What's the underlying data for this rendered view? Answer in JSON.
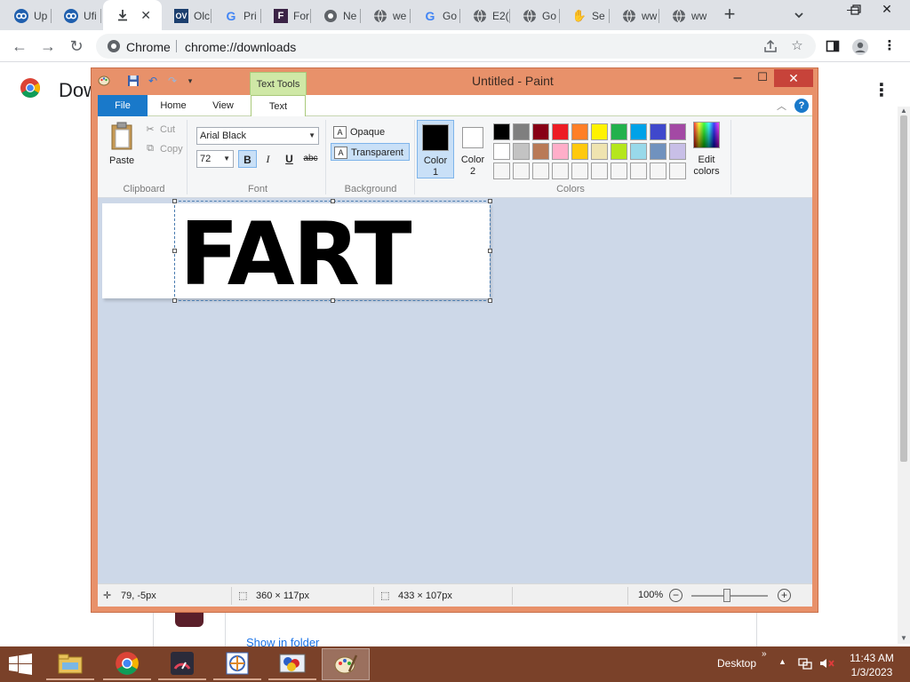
{
  "browser": {
    "tabs": [
      {
        "label": "Up",
        "icon": "blue-loop-icon"
      },
      {
        "label": "Ufi",
        "icon": "blue-loop-icon"
      },
      {
        "label": "",
        "icon": "download-icon",
        "active": true
      },
      {
        "label": "Olc",
        "icon": "ov-logo-icon"
      },
      {
        "label": "Pri",
        "icon": "google-g-icon"
      },
      {
        "label": "For",
        "icon": "f-logo-icon"
      },
      {
        "label": "Ne",
        "icon": "chromium-icon"
      },
      {
        "label": "we",
        "icon": "globe-icon"
      },
      {
        "label": "Go",
        "icon": "google-g-icon"
      },
      {
        "label": "E2(",
        "icon": "globe-icon"
      },
      {
        "label": "Go",
        "icon": "globe-icon"
      },
      {
        "label": "Se",
        "icon": "hand-icon"
      },
      {
        "label": "ww",
        "icon": "globe-icon"
      },
      {
        "label": "ww",
        "icon": "globe-icon"
      }
    ],
    "omnibox_label": "Chrome",
    "url": "chrome://downloads"
  },
  "downloads_page": {
    "title": "Dow",
    "show_in_folder": "Show in folder"
  },
  "paint": {
    "window_title": "Untitled - Paint",
    "context_tab": "Text Tools",
    "ribbon_tabs": {
      "file": "File",
      "home": "Home",
      "view": "View",
      "text": "Text"
    },
    "clipboard": {
      "paste": "Paste",
      "cut": "Cut",
      "copy": "Copy",
      "group": "Clipboard"
    },
    "font": {
      "family": "Arial Black",
      "size": "72",
      "bold": "B",
      "italic": "I",
      "underline": "U",
      "strike": "abc",
      "group": "Font"
    },
    "background": {
      "opaque": "Opaque",
      "transparent": "Transparent",
      "group": "Background"
    },
    "colors": {
      "color1_line1": "Color",
      "color1_line2": "1",
      "color2_line1": "Color",
      "color2_line2": "2",
      "edit_line1": "Edit",
      "edit_line2": "colors",
      "group": "Colors",
      "palette_row1": [
        "#000000",
        "#7f7f7f",
        "#880015",
        "#ed1c24",
        "#ff7f27",
        "#fff200",
        "#22b14c",
        "#00a2e8",
        "#3f48cc",
        "#a349a4"
      ],
      "palette_row2": [
        "#ffffff",
        "#c3c3c3",
        "#b97a57",
        "#ffaec9",
        "#ffc90e",
        "#efe4b0",
        "#b5e61d",
        "#99d9ea",
        "#7092be",
        "#c8bfe7"
      ],
      "palette_row3": [
        "#f5f5f5",
        "#f5f5f5",
        "#f5f5f5",
        "#f5f5f5",
        "#f5f5f5",
        "#f5f5f5",
        "#f5f5f5",
        "#f5f5f5",
        "#f5f5f5",
        "#f5f5f5"
      ]
    },
    "canvas_text": "FART",
    "status": {
      "cursor": "79, -5px",
      "selection": "360 × 117px",
      "canvas": "433 × 107px",
      "zoom": "100%"
    }
  },
  "taskbar": {
    "desktop": "Desktop",
    "time": "11:43 AM",
    "date": "1/3/2023"
  }
}
